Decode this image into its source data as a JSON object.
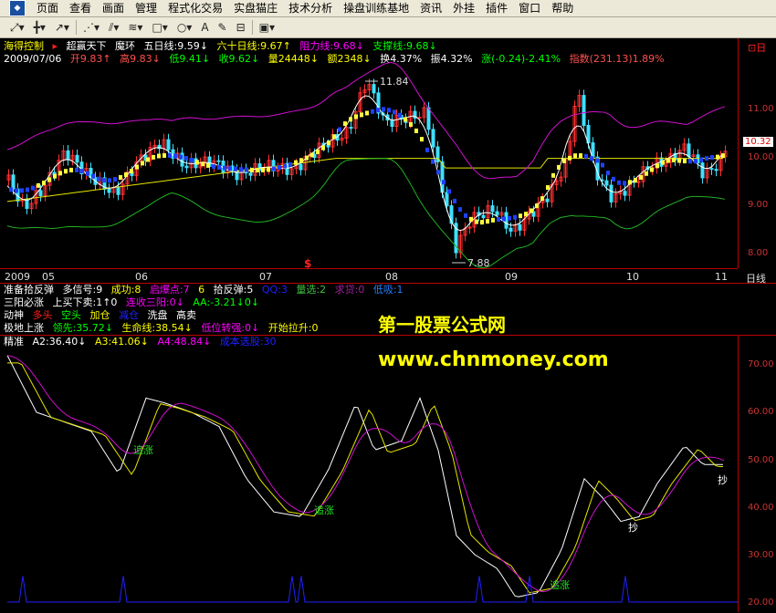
{
  "menu": [
    "页面",
    "查看",
    "画面",
    "管理",
    "程式化交易",
    "实盘猫庄",
    "技术分析",
    "操盘训练基地",
    "资讯",
    "外挂",
    "插件",
    "窗口",
    "帮助"
  ],
  "toolbar": {
    "zoom_label": "▼",
    "cross_label": "+",
    "arrow_label": "↗",
    "text_label": "A",
    "save_label": "▣"
  },
  "header": {
    "name": "海得控制",
    "formula": "超赢天下",
    "formula2": "魔环",
    "ma5": "五日线:9.59↓",
    "ma60": "六十日线:9.67↑",
    "resist": "阻力线:9.68↓",
    "support": "支撑线:9.68↓",
    "pin": "⊡日"
  },
  "quote": {
    "date": "2009/07/06",
    "open": "开9.83↑",
    "high": "高9.83↓",
    "low": "低9.41↓",
    "close": "收9.62↓",
    "vol": "量24448↓",
    "amt": "额2348↓",
    "turn": "换4.37%",
    "amp": "振4.32%",
    "chg": "涨(-0.24)-2.41%",
    "index": "指数(231.13)1.89%"
  },
  "price_axis": {
    "labels": [
      "11.00",
      "10.00",
      "9.00",
      "8.00"
    ],
    "current": "10.32"
  },
  "annotations": {
    "high": "11.84",
    "low": "7.88",
    "marker": "$"
  },
  "xaxis": {
    "labels": [
      "2009",
      "05",
      "06",
      "07",
      "08",
      "09",
      "10",
      "11"
    ],
    "period": "日线"
  },
  "ind1": {
    "title": "准备拾反弹",
    "a": "多信号:9",
    "b": "成功:8",
    "c": "启爆点:7",
    "d": "6",
    "e": "拾反弹:5",
    "f": "QQ:3",
    "g": "量选:2",
    "h": "求贷:0",
    "i": "低吸:1"
  },
  "ind2": {
    "title": "三阳必涨",
    "a": "上买下卖:1↑0",
    "b": "连收三阳:0↓",
    "c": "AA:-3.21↓0↓"
  },
  "ind3": {
    "title": "动神",
    "a": "多头",
    "b": "空头",
    "c": "加仓",
    "d": "减仓",
    "e": "洗盘",
    "f": "高卖"
  },
  "ind4": {
    "title": "极地上涨",
    "a": "领先:35.72↓",
    "b": "生命线:38.54↓",
    "c": "低位转强:0↓",
    "d": "开始拉升:0"
  },
  "ind5": {
    "title": "精准",
    "a": "A2:36.40↓",
    "b": "A3:41.06↓",
    "c": "A4:48.84↓",
    "d": "成本选股:30"
  },
  "watermark": {
    "line1": "第一股票公式网",
    "line2": "www.chnmoney.com"
  },
  "lower_axis": {
    "labels": [
      "70.00",
      "60.00",
      "50.00",
      "40.00",
      "30.00",
      "20.00"
    ]
  },
  "lower_labels": {
    "a": "追涨",
    "b": "追涨",
    "c": "追涨",
    "d": "抄",
    "e": "抄"
  }
}
